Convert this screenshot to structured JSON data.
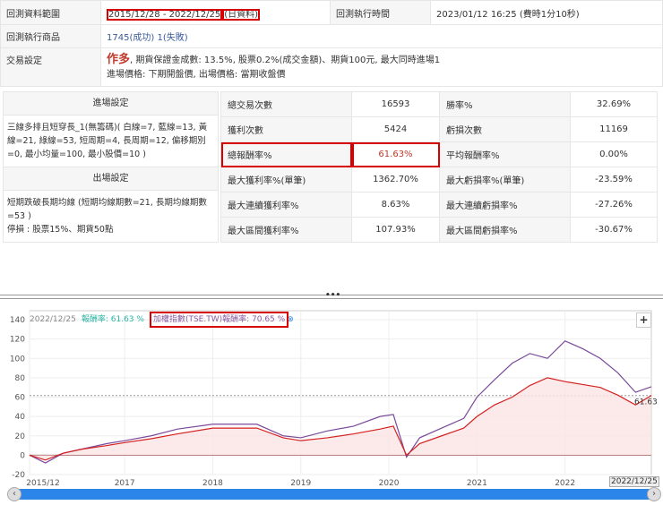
{
  "summary": {
    "range_label": "回測資料範圍",
    "range_value": "2015/12/28 - 2022/12/25",
    "range_type": "(日資料)",
    "time_label": "回測執行時間",
    "time_value": "2023/01/12 16:25 (費時1分10秒)",
    "products_label": "回測執行商品",
    "products_success": "1745(成功)",
    "products_fail": "1(失敗)",
    "trade_label": "交易設定",
    "trade_direction": "作多",
    "trade_line1": ", 期貨保證金成數: 13.5%, 股票0.2%(成交金額)、期貨100元, 最大同時進場1",
    "trade_line2": "進場價格: 下期開盤價, 出場價格: 當期收盤價"
  },
  "entry": {
    "header": "進場設定",
    "body": "三線多排且短穿長_1(無籌碼)( 白線=7, 藍線=13, 黃線=21, 綠線=53, 短周期=4, 長周期=12, 偏移期別=0, 最小均量=100, 最小股價=10 )"
  },
  "exit": {
    "header": "出場設定",
    "body": "短期跌破長期均線 (短期均線期數=21, 長期均線期數=53 )",
    "stop": "停損 : 股票15%、期貨50點"
  },
  "stats": [
    {
      "k1": "總交易次數",
      "v1": "16593",
      "k2": "勝率%",
      "v2": "32.69%"
    },
    {
      "k1": "獲利次數",
      "v1": "5424",
      "k2": "虧損次數",
      "v2": "11169"
    },
    {
      "k1": "總報酬率%",
      "v1": "61.63%",
      "k2": "平均報酬率%",
      "v2": "0.00%"
    },
    {
      "k1": "最大獲利率%(單筆)",
      "v1": "1362.70%",
      "k2": "最大虧損率%(單筆)",
      "v2": "-23.59%"
    },
    {
      "k1": "最大連續獲利率%",
      "v1": "8.63%",
      "k2": "最大連續虧損率%",
      "v2": "-27.26%"
    },
    {
      "k1": "最大區間獲利率%",
      "v1": "107.93%",
      "k2": "最大區間虧損率%",
      "v2": "-30.67%"
    }
  ],
  "divider_handle": "•••",
  "legend": {
    "date": "2022/12/25",
    "strategy": "報酬率: 61.63 %",
    "index": "加權指數(TSE.TW)報酬率: 70.65 %"
  },
  "zoom_button": "+",
  "end_tag": "2022/12/25",
  "chart_data": {
    "type": "line",
    "ylim": [
      -20,
      140
    ],
    "yticks": [
      -20,
      0,
      20,
      40,
      60,
      80,
      100,
      120,
      140
    ],
    "xlim": [
      2015.92,
      2022.98
    ],
    "xticks": [
      {
        "v": 2015.92,
        "l": "2015/12"
      },
      {
        "v": 2017,
        "l": "2017"
      },
      {
        "v": 2018,
        "l": "2018"
      },
      {
        "v": 2019,
        "l": "2019"
      },
      {
        "v": 2020,
        "l": "2020"
      },
      {
        "v": 2021,
        "l": "2021"
      },
      {
        "v": 2022,
        "l": "2022"
      }
    ],
    "last_value_label": "61.63",
    "series": [
      {
        "name": "策略報酬率",
        "color": "#d42020",
        "x": [
          2015.92,
          2016.1,
          2016.3,
          2016.5,
          2016.8,
          2017,
          2017.3,
          2017.6,
          2018,
          2018.5,
          2018.8,
          2019,
          2019.3,
          2019.6,
          2019.9,
          2020.05,
          2020.2,
          2020.35,
          2020.6,
          2020.85,
          2021,
          2021.2,
          2021.4,
          2021.6,
          2021.8,
          2022,
          2022.2,
          2022.4,
          2022.6,
          2022.8,
          2022.98
        ],
        "y": [
          0,
          -5,
          2,
          6,
          10,
          13,
          17,
          22,
          28,
          28,
          18,
          15,
          18,
          22,
          27,
          30,
          0,
          12,
          20,
          28,
          40,
          52,
          60,
          72,
          80,
          76,
          73,
          70,
          62,
          52,
          61.63
        ]
      },
      {
        "name": "加權指數(TSE.TW)",
        "color": "#7a4a9a",
        "x": [
          2015.92,
          2016.1,
          2016.3,
          2016.5,
          2016.8,
          2017,
          2017.3,
          2017.6,
          2018,
          2018.5,
          2018.8,
          2019,
          2019.3,
          2019.6,
          2019.9,
          2020.05,
          2020.2,
          2020.35,
          2020.6,
          2020.85,
          2021,
          2021.2,
          2021.4,
          2021.6,
          2021.8,
          2022,
          2022.2,
          2022.4,
          2022.6,
          2022.8,
          2022.98
        ],
        "y": [
          0,
          -8,
          2,
          6,
          12,
          15,
          20,
          27,
          32,
          32,
          20,
          18,
          25,
          30,
          40,
          42,
          -2,
          18,
          28,
          38,
          60,
          78,
          95,
          105,
          100,
          118,
          110,
          100,
          85,
          65,
          70.65
        ]
      }
    ]
  }
}
